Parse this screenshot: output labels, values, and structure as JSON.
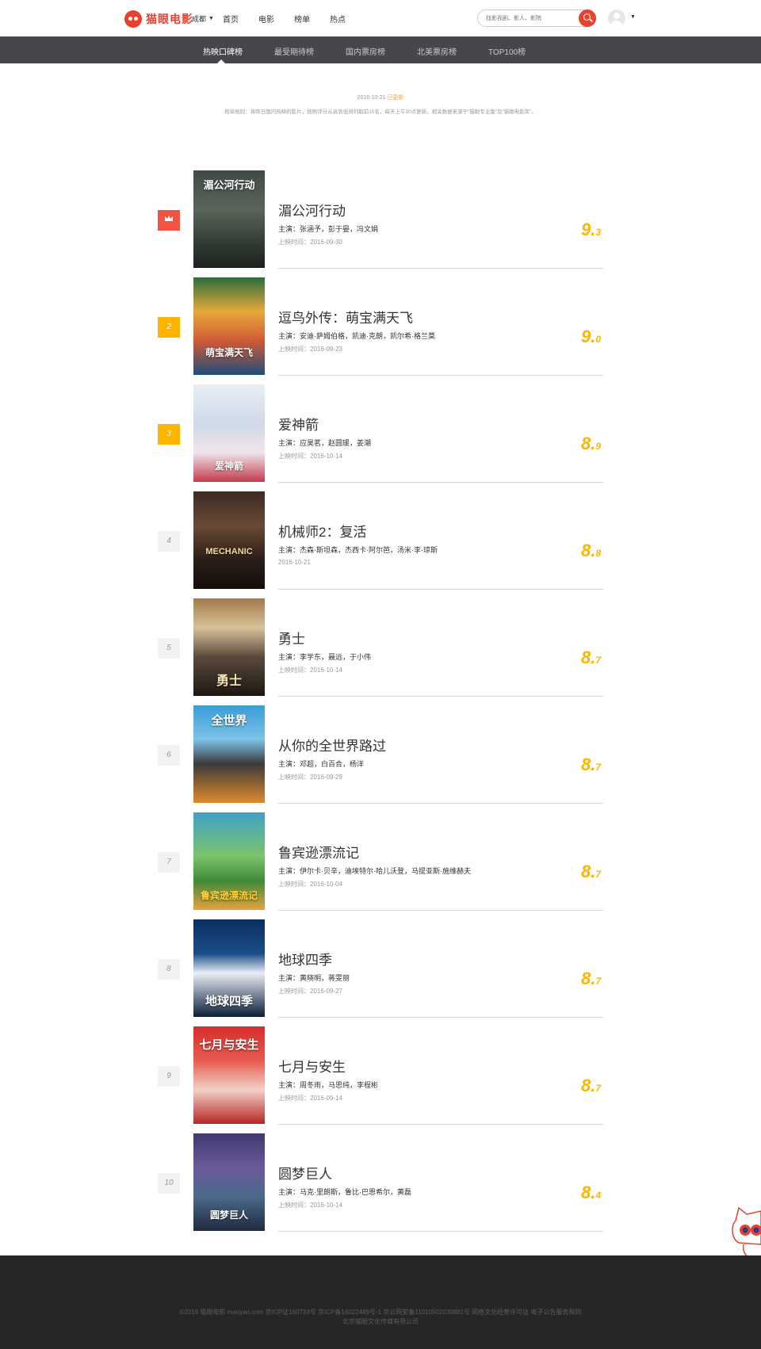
{
  "header": {
    "logo_text": "猫眼电影",
    "city": "成都",
    "nav": [
      "首页",
      "电影",
      "榜单",
      "热点"
    ],
    "search_placeholder": "找影视剧、影人、影院"
  },
  "subnav": {
    "tabs": [
      "热映口碑榜",
      "最受期待榜",
      "国内票房榜",
      "北美票房榜",
      "TOP100榜"
    ],
    "active": "热映口碑榜"
  },
  "update": {
    "date": "2016-10-21",
    "tag": "已更新",
    "rule": "榜单规则：将昨日国内热映的影片，按照评分从高到低排列取前10名，每天上午10点更新。相关数据来源于“猫眼专业版”及“猫眼电影库”。"
  },
  "movies": [
    {
      "rank": "1",
      "title": "湄公河行动",
      "actors": "主演：张涵予，彭于晏，冯文娟",
      "date": "上映时间：2016-09-30",
      "score_int": "9.",
      "score_frac": "3",
      "poster_text": "湄公河行动"
    },
    {
      "rank": "2",
      "title": "逗鸟外传：萌宝满天飞",
      "actors": "主演：安迪·萨姆伯格，凯迪·克朗，凯尔希·格兰莫",
      "date": "上映时间：2016-09-23",
      "score_int": "9.",
      "score_frac": "0",
      "poster_text": "萌宝满天飞"
    },
    {
      "rank": "3",
      "title": "爱神箭",
      "actors": "主演：应昊茗，赵圆瑗，姜潮",
      "date": "上映时间：2016-10-14",
      "score_int": "8.",
      "score_frac": "9",
      "poster_text": "爱神箭"
    },
    {
      "rank": "4",
      "title": "机械师2：复活",
      "actors": "主演：杰森·斯坦森，杰西卡·阿尔芭，汤米·李·琼斯",
      "date": "2016-10-21",
      "score_int": "8.",
      "score_frac": "8",
      "poster_text": "MECHANIC"
    },
    {
      "rank": "5",
      "title": "勇士",
      "actors": "主演：李学东，聂远，于小伟",
      "date": "上映时间：2016-10-14",
      "score_int": "8.",
      "score_frac": "7",
      "poster_text": "勇士"
    },
    {
      "rank": "6",
      "title": "从你的全世界路过",
      "actors": "主演：邓超，白百合，杨洋",
      "date": "上映时间：2016-09-29",
      "score_int": "8.",
      "score_frac": "7",
      "poster_text": "全世界"
    },
    {
      "rank": "7",
      "title": "鲁宾逊漂流记",
      "actors": "主演：伊尔卡·贝辛，迪埃特尔·哈儿沃登，马提亚斯·施维赫夫",
      "date": "上映时间：2016-10-04",
      "score_int": "8.",
      "score_frac": "7",
      "poster_text": "鲁宾逊漂流记"
    },
    {
      "rank": "8",
      "title": "地球四季",
      "actors": "主演：黄晓明，蒋雯丽",
      "date": "上映时间：2016-09-27",
      "score_int": "8.",
      "score_frac": "7",
      "poster_text": "地球四季"
    },
    {
      "rank": "9",
      "title": "七月与安生",
      "actors": "主演：周冬雨，马思纯，李程彬",
      "date": "上映时间：2016-09-14",
      "score_int": "8.",
      "score_frac": "7",
      "poster_text": "七月与安生"
    },
    {
      "rank": "10",
      "title": "圆梦巨人",
      "actors": "主演：马克·里朗斯，鲁比·巴恩希尔，黄磊",
      "date": "上映时间：2016-10-14",
      "score_int": "8.",
      "score_frac": "4",
      "poster_text": "圆梦巨人"
    }
  ],
  "footer": {
    "line1": "©2016 猫眼电影 maoyan.com 京ICP证160733号 京ICP备16022489号-1 京公网安备11010502030881号 网络文化经营许可证 电子公告服务规则",
    "line2": "北京猫眼文化传媒有限公司"
  },
  "colors": {
    "brand": "#e8412f",
    "score": "#ffb400",
    "subnav_bg": "#47464a",
    "footer_bg": "#262626",
    "rank_top": "#f05543",
    "rank_gold": "#ffb400"
  }
}
